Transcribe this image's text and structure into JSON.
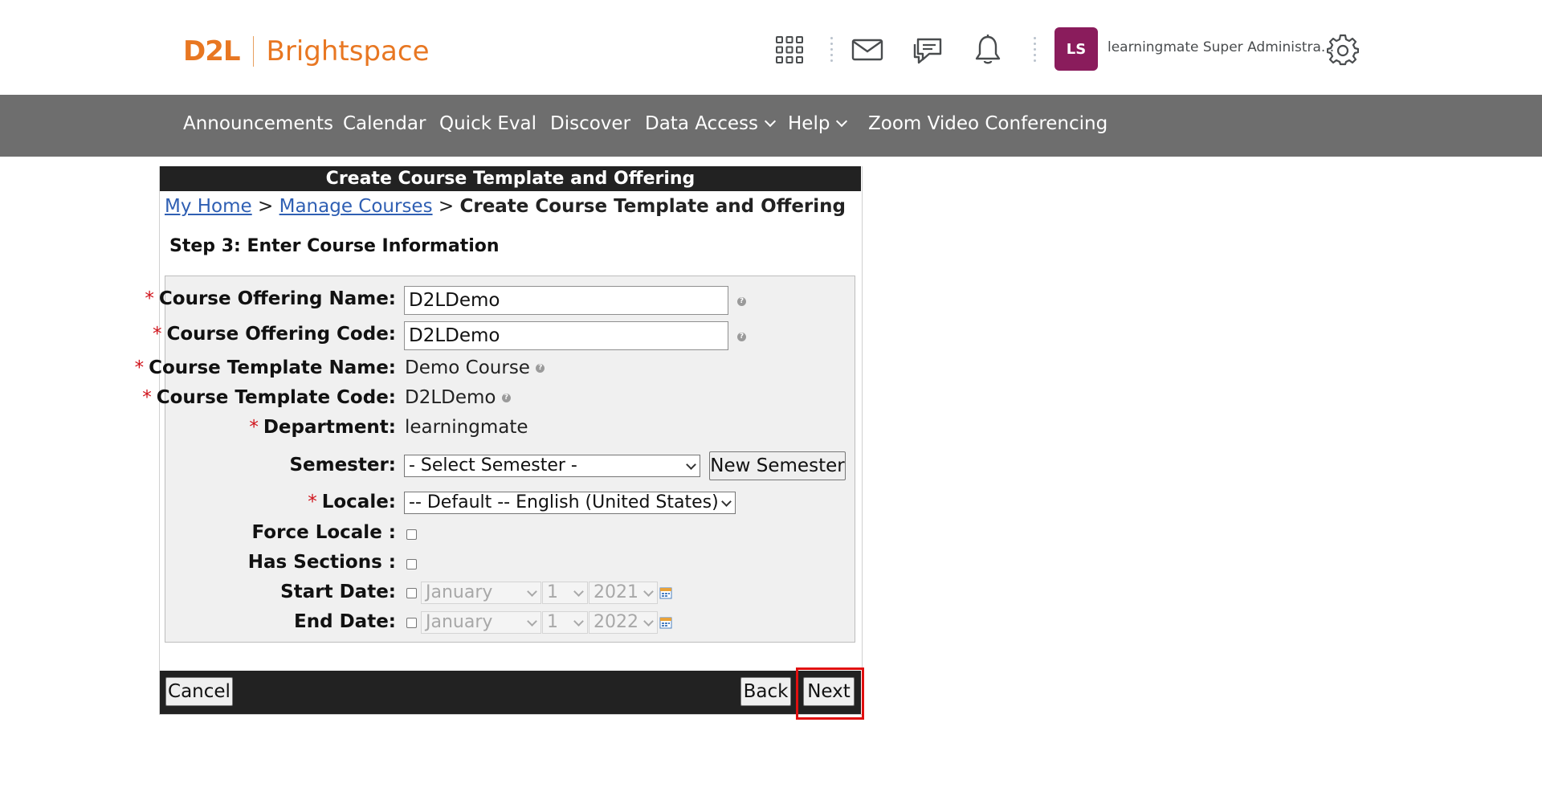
{
  "header": {
    "logo_d2l": "D2L",
    "logo_brightspace": "Brightspace",
    "avatar_initials": "LS",
    "username": "learningmate Super Administra...",
    "brand_color": "#e87722",
    "avatar_color": "#8a1c5c"
  },
  "nav": {
    "items": [
      {
        "label": "Announcements"
      },
      {
        "label": "Calendar"
      },
      {
        "label": "Quick Eval"
      },
      {
        "label": "Discover"
      },
      {
        "label": "Data Access"
      },
      {
        "label": "Help"
      },
      {
        "label": "Zoom Video Conferencing"
      }
    ]
  },
  "panel": {
    "title": "Create Course Template and Offering",
    "breadcrumb": {
      "home": "My Home",
      "sep": ">",
      "manage": "Manage Courses",
      "current": "Create Course Template and Offering"
    },
    "step_heading": "Step 3: Enter Course Information"
  },
  "form": {
    "required_mark": "*",
    "offering_name": {
      "label": "Course Offering Name:",
      "value": "D2LDemo"
    },
    "offering_code": {
      "label": "Course Offering Code:",
      "value": "D2LDemo"
    },
    "template_name": {
      "label": "Course Template Name:",
      "value": "Demo Course"
    },
    "template_code": {
      "label": "Course Template Code:",
      "value": "D2LDemo"
    },
    "department": {
      "label": "Department:",
      "value": "learningmate"
    },
    "semester": {
      "label": "Semester:",
      "selected": "- Select Semester -",
      "new_button": "New Semester"
    },
    "locale": {
      "label": "Locale:",
      "selected": "-- Default -- English (United States)"
    },
    "force_locale": {
      "label": "Force Locale :",
      "checked": false
    },
    "has_sections": {
      "label": "Has Sections :",
      "checked": false
    },
    "start_date": {
      "label": "Start Date:",
      "month": "January",
      "day": "1",
      "year": "2021",
      "enabled": false
    },
    "end_date": {
      "label": "End Date:",
      "month": "January",
      "day": "1",
      "year": "2022",
      "enabled": false
    }
  },
  "footer": {
    "cancel": "Cancel",
    "back": "Back",
    "next": "Next"
  }
}
